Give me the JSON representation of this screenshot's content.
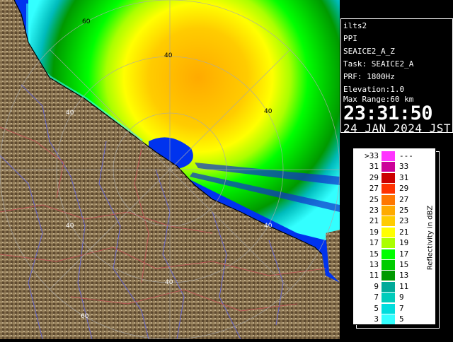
{
  "info": {
    "radar": "ilts2",
    "product": "PPI",
    "product_name": "SEAICE2_A_Z",
    "task": "Task: SEAICE2_A",
    "prf": "PRF: 1800Hz",
    "elevation": "Elevation:1.0",
    "max_range": "Max Range:60 km",
    "time": "23:31:50",
    "date": "24 JAN 2024 JST"
  },
  "legend": {
    "title": "Reflectivity in dBZ",
    "rows": [
      {
        "lo": ">33",
        "hi": "---",
        "color": "#ff33ff"
      },
      {
        "lo": "31",
        "hi": "33",
        "color": "#cc0099"
      },
      {
        "lo": "29",
        "hi": "31",
        "color": "#cc0000"
      },
      {
        "lo": "27",
        "hi": "29",
        "color": "#ff3300"
      },
      {
        "lo": "25",
        "hi": "27",
        "color": "#ff7700"
      },
      {
        "lo": "23",
        "hi": "25",
        "color": "#ffaa00"
      },
      {
        "lo": "21",
        "hi": "23",
        "color": "#ffcc00"
      },
      {
        "lo": "19",
        "hi": "21",
        "color": "#ffff00"
      },
      {
        "lo": "17",
        "hi": "19",
        "color": "#aaff00"
      },
      {
        "lo": "15",
        "hi": "17",
        "color": "#00ff00"
      },
      {
        "lo": "13",
        "hi": "15",
        "color": "#00cc00"
      },
      {
        "lo": "11",
        "hi": "13",
        "color": "#009900"
      },
      {
        "lo": "9",
        "hi": "11",
        "color": "#00aa99"
      },
      {
        "lo": "7",
        "hi": "9",
        "color": "#00ccbb"
      },
      {
        "lo": "5",
        "hi": "7",
        "color": "#00dddd"
      },
      {
        "lo": "3",
        "hi": "5",
        "color": "#33ffff"
      }
    ]
  },
  "map": {
    "colors": {
      "sea": "#0033ee",
      "land": "#806a48",
      "rings": "#aaaaaa",
      "rivers": "#6666cc",
      "roads": "#bb5555"
    },
    "range_labels": [
      "60",
      "40",
      "40",
      "40",
      "40",
      "40",
      "40",
      "60"
    ]
  }
}
